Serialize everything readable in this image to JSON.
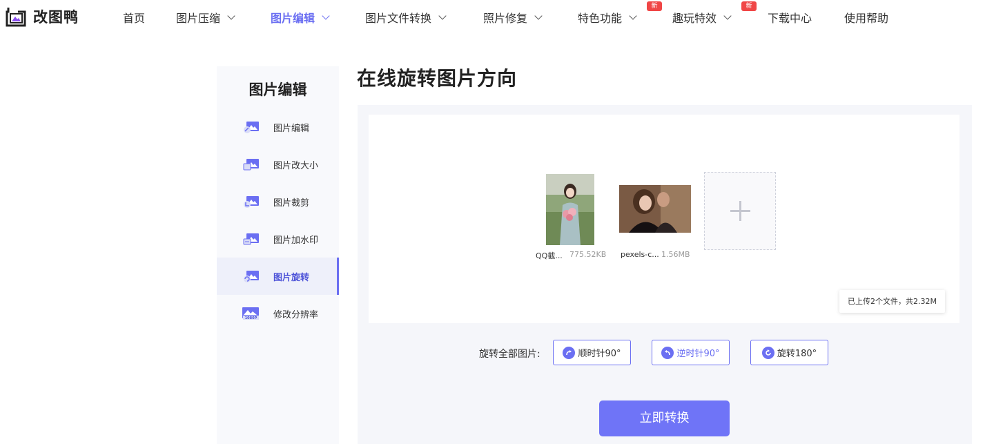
{
  "brand": {
    "name": "改图鸭"
  },
  "nav": {
    "items": [
      {
        "label": "首页"
      },
      {
        "label": "图片压缩"
      },
      {
        "label": "图片编辑"
      },
      {
        "label": "图片文件转换"
      },
      {
        "label": "照片修复"
      },
      {
        "label": "特色功能",
        "badge": "新"
      },
      {
        "label": "趣玩特效",
        "badge": "新"
      },
      {
        "label": "下载中心"
      },
      {
        "label": "使用帮助"
      }
    ],
    "active_index": 2
  },
  "sidebar": {
    "title": "图片编辑",
    "items": [
      {
        "label": "图片编辑",
        "icon": "image-edit-icon"
      },
      {
        "label": "图片改大小",
        "icon": "image-resize-icon"
      },
      {
        "label": "图片裁剪",
        "icon": "image-crop-icon"
      },
      {
        "label": "图片加水印",
        "icon": "image-watermark-icon"
      },
      {
        "label": "图片旋转",
        "icon": "image-rotate-icon"
      },
      {
        "label": "修改分辨率",
        "icon": "image-resolution-icon",
        "icon_text": "1080P"
      }
    ],
    "active_index": 4
  },
  "main": {
    "title": "在线旋转图片方向",
    "files": [
      {
        "name": "QQ截...",
        "size": "775.52KB"
      },
      {
        "name": "pexels-c...",
        "size": "1.56MB"
      }
    ],
    "summary": "已上传2个文件，共2.32M",
    "rotate_all_label": "旋转全部图片:",
    "rotate_buttons": {
      "cw": "顺时针90°",
      "ccw": "逆时针90°",
      "r180": "旋转180°"
    },
    "convert_button": "立即转换"
  },
  "colors": {
    "accent": "#6b6ff2",
    "badge": "#f04646",
    "primary_button": "#6f74f7"
  }
}
